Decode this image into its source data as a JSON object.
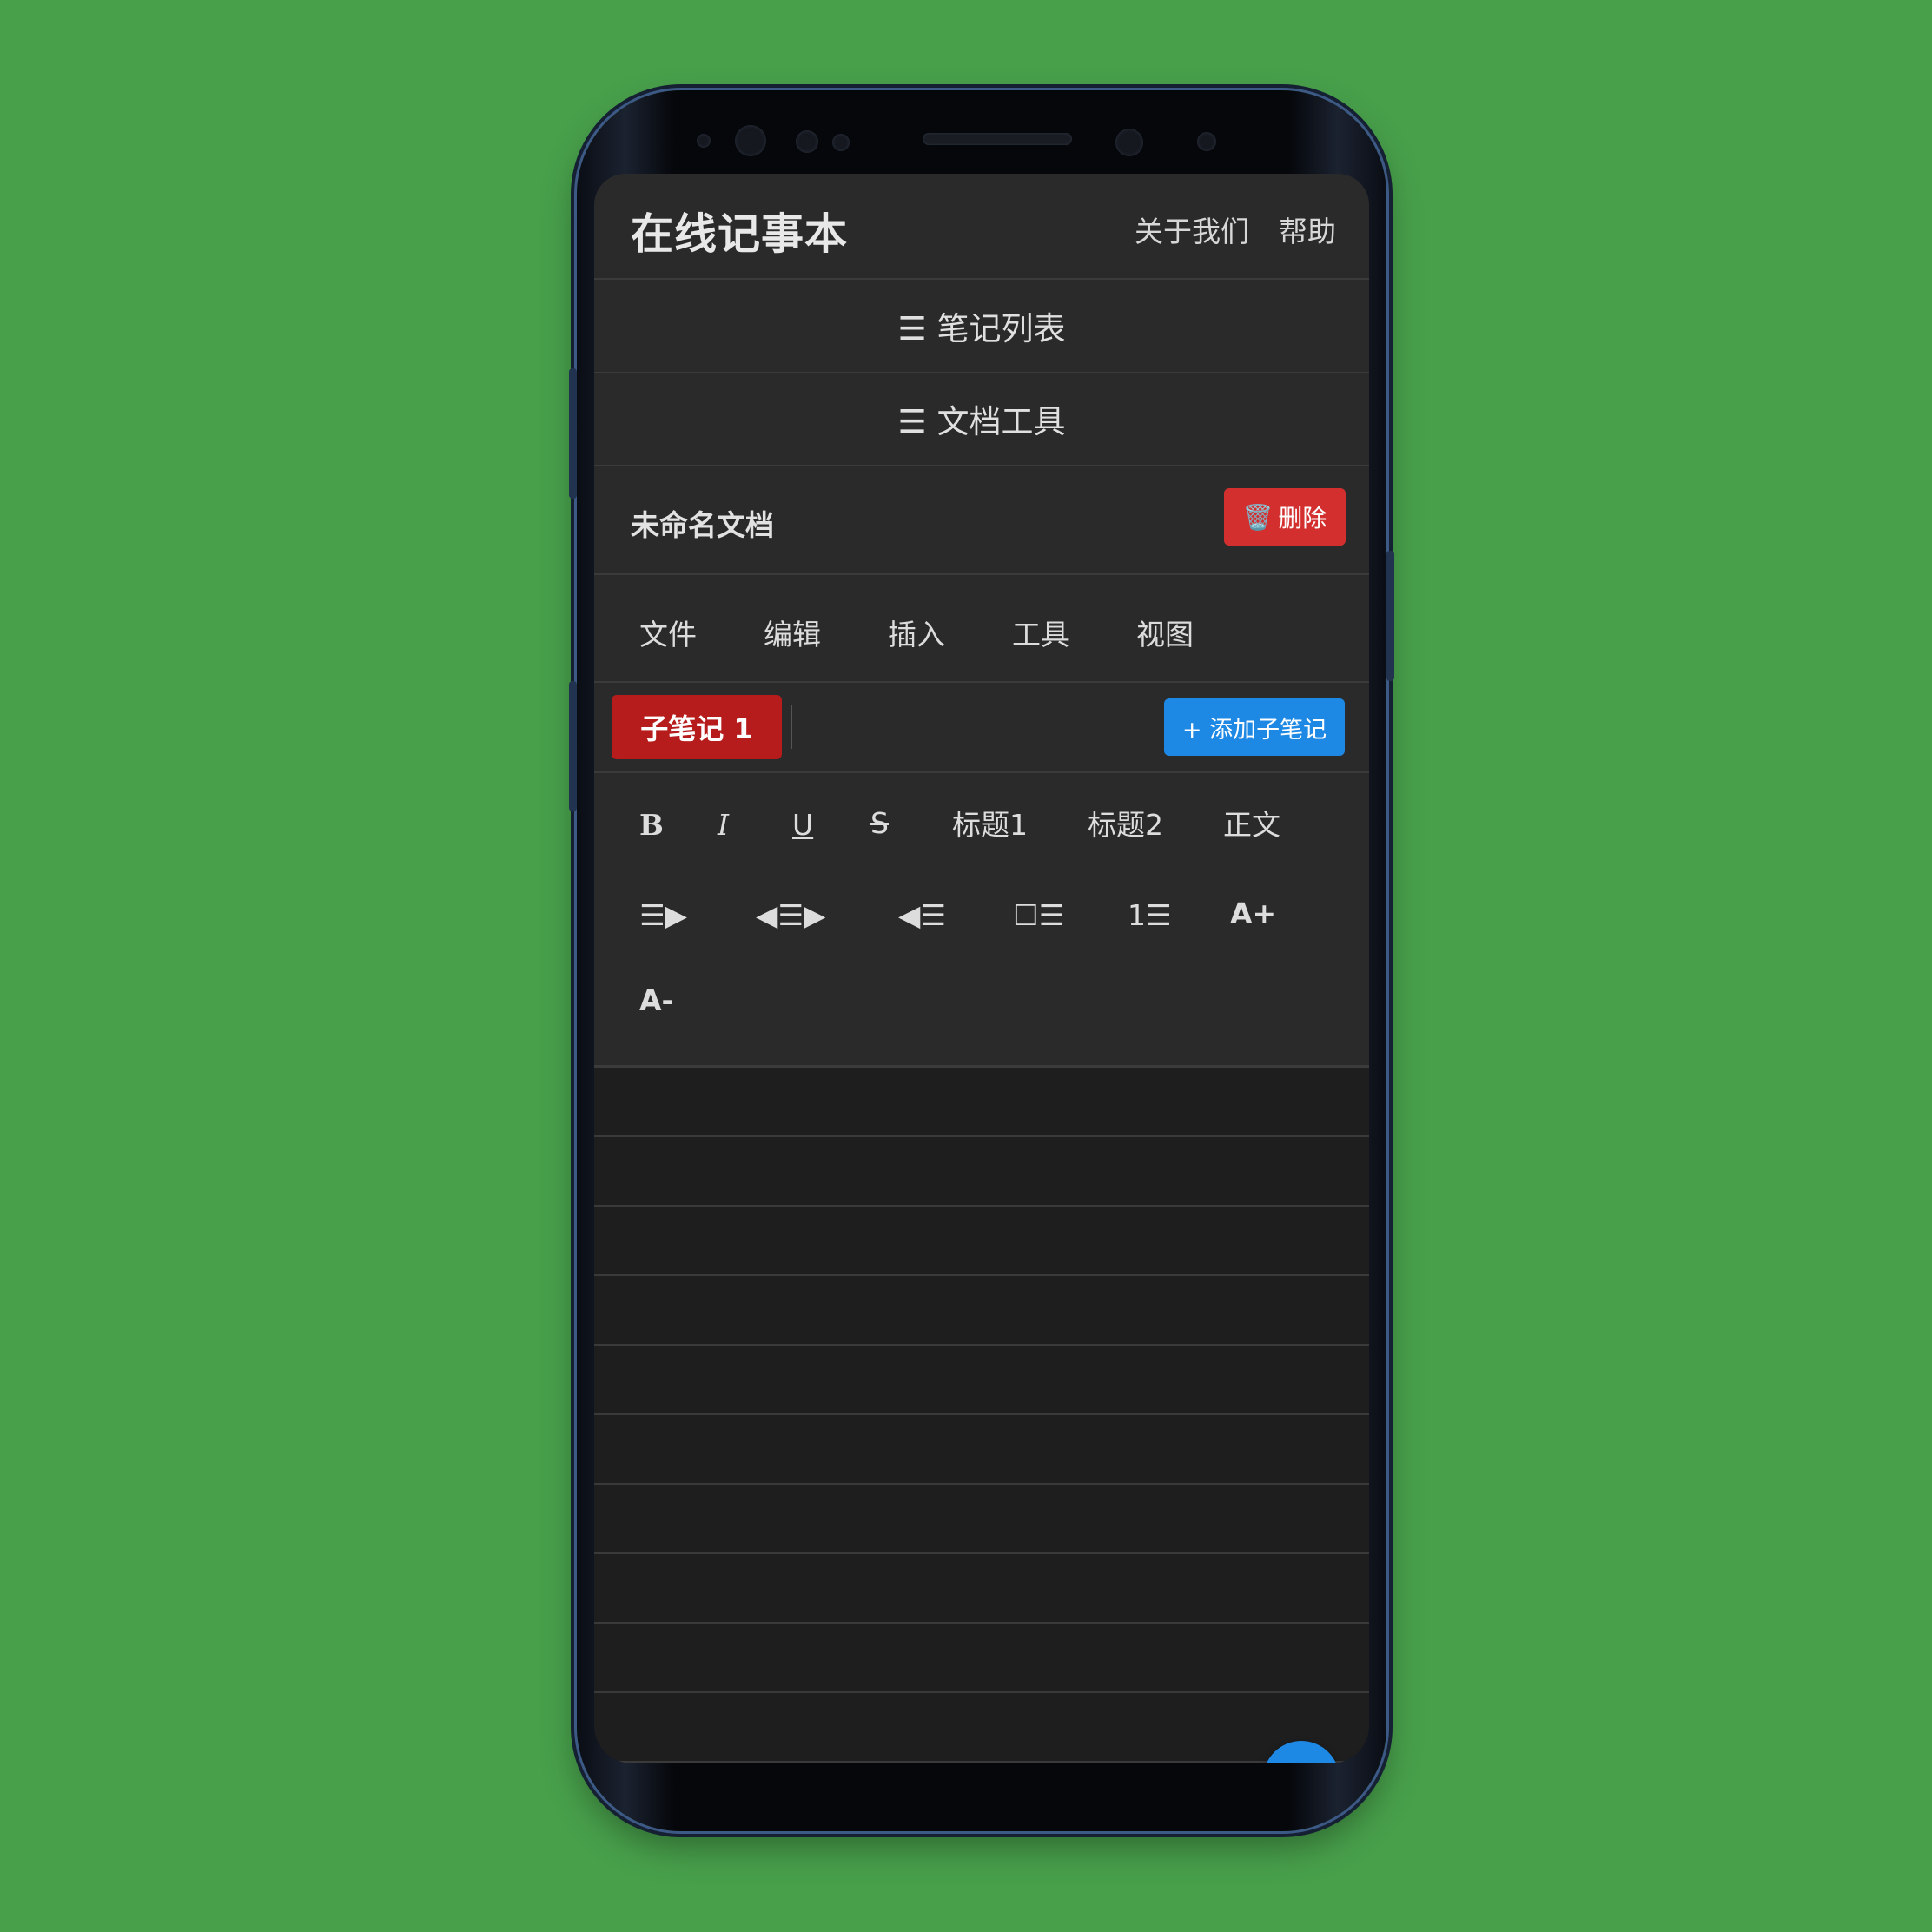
{
  "app": {
    "title": "在线记事本",
    "nav": {
      "about": "关于我们",
      "help": "帮助"
    }
  },
  "sections": {
    "notes_list": "☰ 笔记列表",
    "doc_tools": "☰ 文档工具"
  },
  "document": {
    "title": "未命名文档",
    "delete_icon": "🗑️",
    "delete_label": "删除"
  },
  "menu": [
    "文件",
    "编辑",
    "插入",
    "工具",
    "视图"
  ],
  "subnotes": {
    "active_tab": "子笔记 1",
    "add_label": "+ 添加子笔记"
  },
  "format_toolbar": {
    "bold": "B",
    "italic": "I",
    "underline": "U",
    "strike": "S",
    "heading1": "标题1",
    "heading2": "标题2",
    "body": "正文",
    "indent": "☰▶",
    "center": "◀☰▶",
    "outdent": "◀☰",
    "checklist": "☐☰",
    "numbered": "1☰",
    "font_bigger": "A+",
    "font_smaller": "A-"
  },
  "fab_icon": "expand-arrows-icon",
  "colors": {
    "background": "#48a04b",
    "panel": "#2a2a2a",
    "editor": "#1e1e1e",
    "delete": "#d32f2f",
    "tab_active": "#b71c1c",
    "accent": "#1e88e5"
  }
}
